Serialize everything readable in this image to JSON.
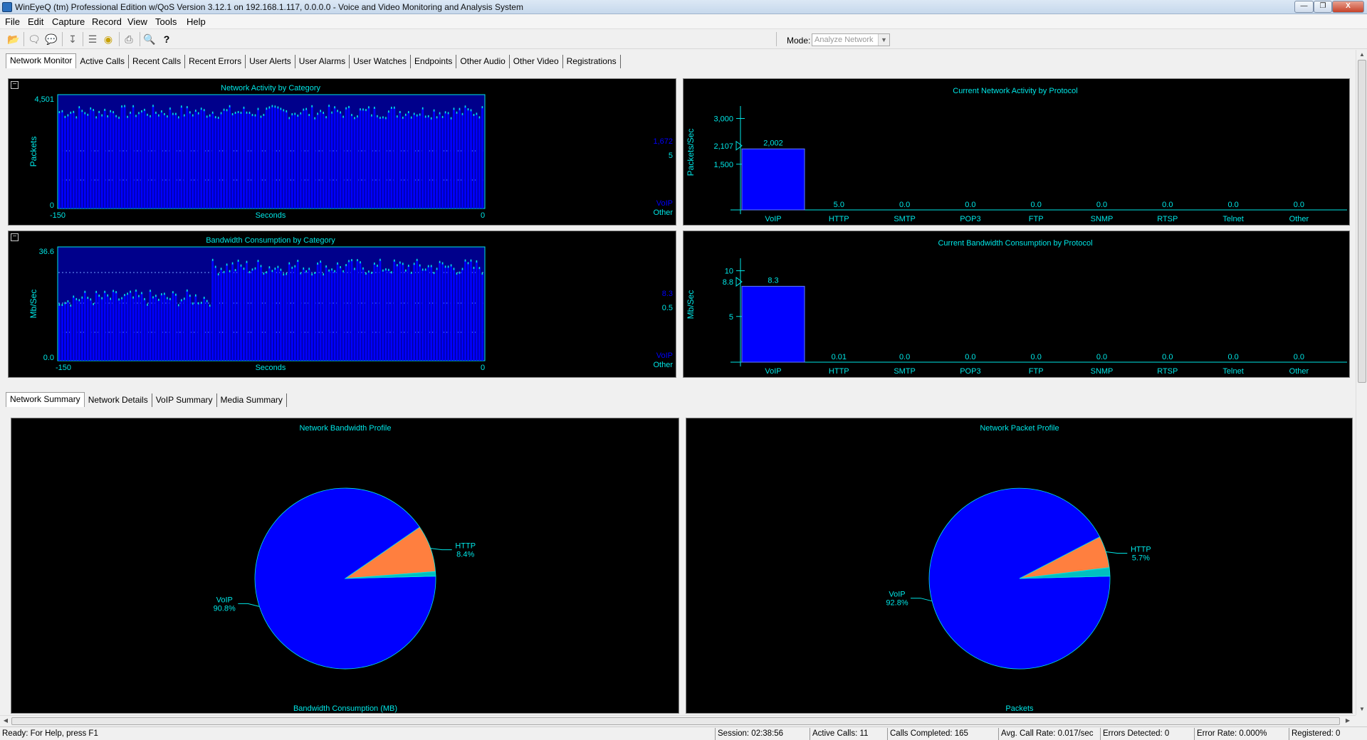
{
  "window": {
    "title": "WinEyeQ (tm) Professional Edition w/QoS Version 3.12.1 on 192.168.1.117, 0.0.0.0 - Voice and Video Monitoring and Analysis System",
    "min_glyph": "—",
    "max_glyph": "❐",
    "close_glyph": "X"
  },
  "menu": [
    "File",
    "Edit",
    "Capture",
    "Record",
    "View",
    "Tools",
    "Help"
  ],
  "toolbar": {
    "mode_label": "Mode:",
    "mode_value": "Analyze Network"
  },
  "colors": {
    "panel_bg": "#000000",
    "accent_cyan": "#00e6e6",
    "bar_blue": "#0000ff",
    "http_orange": "#ff7f3f"
  },
  "top_tabs": [
    "Network Monitor",
    "Active Calls",
    "Recent Calls",
    "Recent Errors",
    "User Alerts",
    "User Alarms",
    "User Watches",
    "Endpoints",
    "Other Audio",
    "Other Video",
    "Registrations"
  ],
  "top_tabs_active": "Network Monitor",
  "bottom_tabs": [
    "Network Summary",
    "Network Details",
    "VoIP Summary",
    "Media Summary"
  ],
  "bottom_tabs_active": "Network Summary",
  "network_activity": {
    "title": "Network Activity by Category",
    "ylabel": "Packets",
    "xlabel": "Seconds",
    "ymax_label": "4,501",
    "ymin_label": "0",
    "xmin_label": "-150",
    "xmax_label": "0",
    "side_value_1": "1,672",
    "side_value_2": "5",
    "side_series_1": "VoIP",
    "side_series_2": "Other"
  },
  "bandwidth_category": {
    "title": "Bandwidth Consumption by Category",
    "ylabel": "Mb/Sec",
    "xlabel": "Seconds",
    "ymax_label": "36.6",
    "ymin_label": "0.0",
    "xmin_label": "-150",
    "xmax_label": "0",
    "side_value_1": "8.3",
    "side_value_2": "0.5",
    "side_series_1": "VoIP",
    "side_series_2": "Other"
  },
  "chart_data": [
    {
      "type": "bar",
      "title": "Network Activity by Category",
      "xlabel": "Seconds",
      "ylabel": "Packets",
      "x_range": [
        -150,
        0
      ],
      "ylim": [
        0,
        4501
      ],
      "note_values": {
        "VoIP": 1672,
        "Other": 5
      },
      "approx_level": 3800
    },
    {
      "type": "bar",
      "title": "Bandwidth Consumption by Category",
      "xlabel": "Seconds",
      "ylabel": "Mb/Sec",
      "x_range": [
        -150,
        0
      ],
      "ylim": [
        0,
        36.6
      ],
      "note_values": {
        "VoIP": 8.3,
        "Other": 0.5
      },
      "approx_level_early": 20,
      "approx_level_late": 30
    },
    {
      "type": "bar",
      "title": "Current Network Activity by Protocol",
      "ylabel": "Packets/Sec",
      "categories": [
        "VoIP",
        "HTTP",
        "SMTP",
        "POP3",
        "FTP",
        "SNMP",
        "RTSP",
        "Telnet",
        "Other"
      ],
      "value_labels": [
        "2,002",
        "5.0",
        "0.0",
        "0.0",
        "0.0",
        "0.0",
        "0.0",
        "0.0",
        "0.0"
      ],
      "values": [
        2002,
        5.0,
        0,
        0,
        0,
        0,
        0,
        0,
        0
      ],
      "y_ticks": [
        "3,000",
        "1,500"
      ],
      "y_tick_values": [
        3000,
        1500
      ],
      "marker_label": "2,107",
      "marker_value": 2107,
      "ylim": [
        0,
        3000
      ]
    },
    {
      "type": "bar",
      "title": "Current Bandwidth Consumption by Protocol",
      "ylabel": "Mb/Sec",
      "categories": [
        "VoIP",
        "HTTP",
        "SMTP",
        "POP3",
        "FTP",
        "SNMP",
        "RTSP",
        "Telnet",
        "Other"
      ],
      "value_labels": [
        "8.3",
        "0.01",
        "0.0",
        "0.0",
        "0.0",
        "0.0",
        "0.0",
        "0.0",
        "0.0"
      ],
      "values": [
        8.3,
        0.01,
        0,
        0,
        0,
        0,
        0,
        0,
        0
      ],
      "y_ticks": [
        "10",
        "5"
      ],
      "y_tick_values": [
        10,
        5
      ],
      "marker_label": "8.8",
      "marker_value": 8.8,
      "ylim": [
        0,
        10
      ]
    },
    {
      "type": "pie",
      "title": "Network Bandwidth Profile",
      "footer": "Bandwidth Consumption (MB)",
      "slices": [
        {
          "name": "VoIP",
          "label": "90.8%",
          "value": 90.8
        },
        {
          "name": "HTTP",
          "label": "8.4%",
          "value": 8.4
        },
        {
          "name": "",
          "label": "",
          "value": 0.8
        }
      ]
    },
    {
      "type": "pie",
      "title": "Network Packet Profile",
      "footer": "Packets",
      "slices": [
        {
          "name": "VoIP",
          "label": "92.8%",
          "value": 92.8
        },
        {
          "name": "HTTP",
          "label": "5.7%",
          "value": 5.7
        },
        {
          "name": "",
          "label": "",
          "value": 1.5
        }
      ]
    }
  ],
  "status": {
    "help": "Ready: For Help, press F1",
    "session": "Session: 02:38:56",
    "active_calls": "Active Calls: 11",
    "calls_completed": "Calls Completed: 165",
    "avg_call_rate": "Avg. Call Rate: 0.017/sec",
    "errors_detected": "Errors Detected: 0",
    "error_rate": "Error Rate: 0.000%",
    "registered": "Registered: 0"
  }
}
